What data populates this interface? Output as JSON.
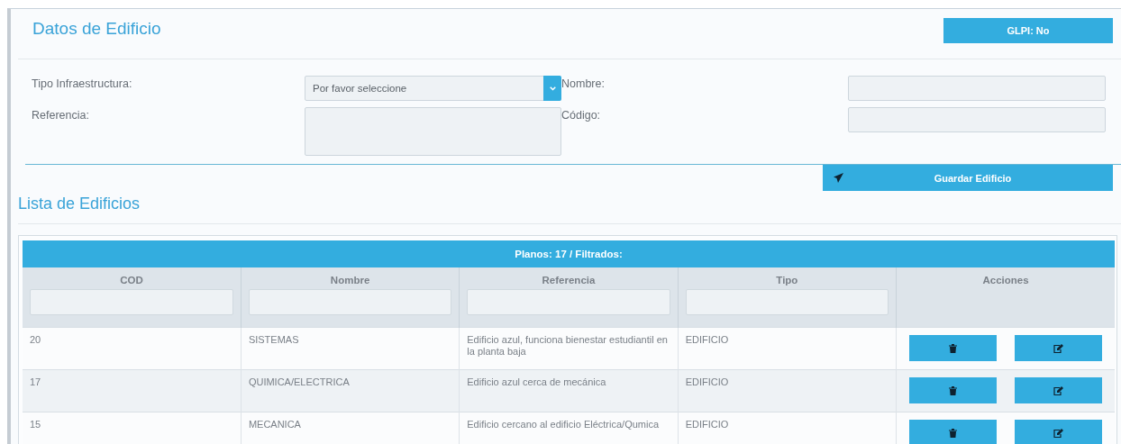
{
  "header": {
    "title": "Datos de Edificio",
    "glpi_button": "GLPI: No"
  },
  "form": {
    "fields": [
      {
        "kind": "select",
        "label": "Tipo Infraestructura:",
        "placeholder": "Por favor seleccione"
      },
      {
        "kind": "input",
        "label": "Nombre:"
      },
      {
        "kind": "textarea",
        "label": "Referencia:"
      },
      {
        "kind": "input",
        "label": "Código:"
      }
    ],
    "save_button": "Guardar Edificio"
  },
  "list": {
    "title": "Lista de Edificios",
    "caption": "Planos: 17 / Filtrados:",
    "columns": [
      {
        "label": "COD",
        "filter": true
      },
      {
        "label": "Nombre",
        "filter": true
      },
      {
        "label": "Referencia",
        "filter": true
      },
      {
        "label": "Tipo",
        "filter": true
      },
      {
        "label": "Acciones",
        "filter": false
      }
    ],
    "rows": [
      {
        "cells": [
          "20",
          "SISTEMAS",
          "Edificio azul, funciona bienestar estudiantil en la planta baja",
          "EDIFICIO"
        ]
      },
      {
        "cells": [
          "17",
          "QUIMICA/ELECTRICA",
          "Edificio azul cerca de mecánica",
          "EDIFICIO"
        ]
      },
      {
        "cells": [
          "15",
          "MECANICA",
          "Edificio cercano al edificio Eléctrica/Qumica",
          "EDIFICIO"
        ]
      }
    ]
  }
}
